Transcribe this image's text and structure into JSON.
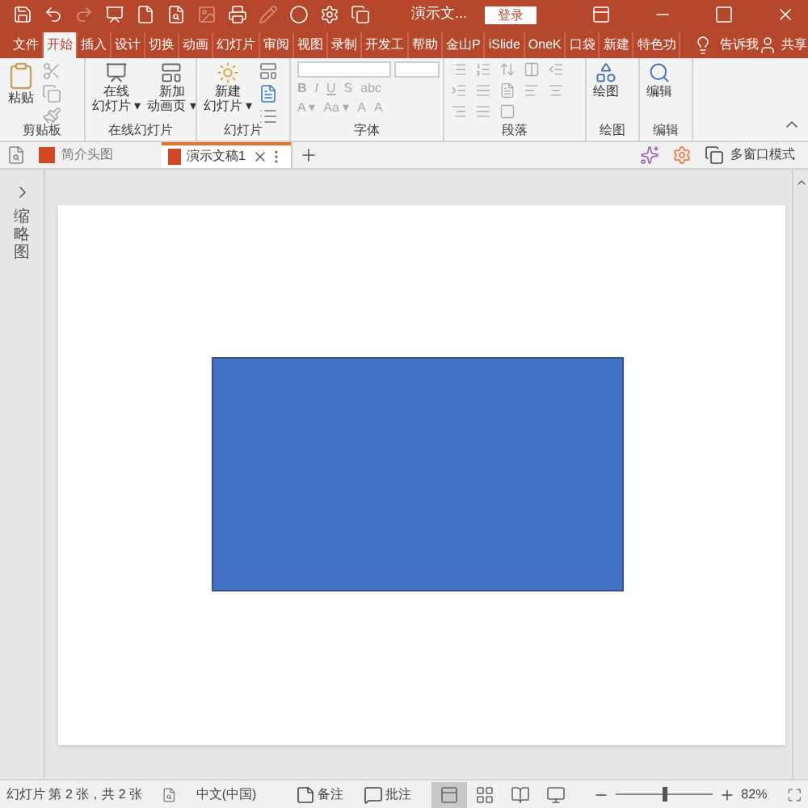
{
  "title_bar": {
    "title": "演示文...",
    "login_button": "登录"
  },
  "ribbon_tabs": [
    {
      "label": "文件",
      "selected": false
    },
    {
      "label": "开始",
      "selected": true
    },
    {
      "label": "插入",
      "selected": false
    },
    {
      "label": "设计",
      "selected": false
    },
    {
      "label": "切换",
      "selected": false
    },
    {
      "label": "动画",
      "selected": false
    },
    {
      "label": "幻灯片",
      "selected": false
    },
    {
      "label": "审阅",
      "selected": false
    },
    {
      "label": "视图",
      "selected": false
    },
    {
      "label": "录制",
      "selected": false
    },
    {
      "label": "开发工",
      "selected": false
    },
    {
      "label": "帮助",
      "selected": false
    },
    {
      "label": "金山P",
      "selected": false
    },
    {
      "label": "iSlide",
      "selected": false
    },
    {
      "label": "OneK",
      "selected": false
    },
    {
      "label": "口袋",
      "selected": false
    },
    {
      "label": "新建",
      "selected": false
    },
    {
      "label": "特色功",
      "selected": false
    }
  ],
  "tell_me": "告诉我",
  "share": "共享",
  "ribbon": {
    "clipboard": {
      "paste": "粘贴",
      "label": "剪贴板"
    },
    "online_slides": {
      "buttons": [
        {
          "lines": [
            "在线",
            "幻灯片 ▾"
          ]
        },
        {
          "lines": [
            "新加",
            "动画页 ▾"
          ]
        }
      ],
      "label": "在线幻灯片"
    },
    "slides": {
      "buttons": [
        {
          "lines": [
            "新建",
            "幻灯片 ▾"
          ]
        }
      ],
      "label": "幻灯片"
    },
    "font": {
      "row_1": [
        "B",
        "I",
        "U",
        "S",
        "abc"
      ],
      "row_2": [
        "A ▾",
        "Aa ▾",
        "A",
        "A"
      ],
      "label": "字体"
    },
    "paragraph": {
      "label": "段落"
    },
    "drawing": {
      "button": "绘图",
      "label": "绘图"
    },
    "editing": {
      "button": "编辑",
      "label": "编辑"
    }
  },
  "document_tabs": [
    {
      "label": "简介头图",
      "selected": false
    },
    {
      "label": "演示文稿1",
      "selected": true
    }
  ],
  "multi_window": "多窗口模式",
  "thumbnails_label": "缩略图",
  "slide": {
    "shapes": [
      {
        "kind": "rectangle"
      }
    ]
  },
  "status_bar": {
    "slide_info": "幻灯片 第 2 张，共 2 张",
    "language": "中文(中国)",
    "notes": "备注",
    "comments": "批注",
    "views": [
      {
        "kind": "normal",
        "selected": true
      },
      {
        "kind": "sorter",
        "selected": false
      },
      {
        "kind": "reading",
        "selected": false
      },
      {
        "kind": "show",
        "selected": false
      }
    ],
    "zoom": {
      "level": 0.5,
      "reading": "82%"
    }
  }
}
